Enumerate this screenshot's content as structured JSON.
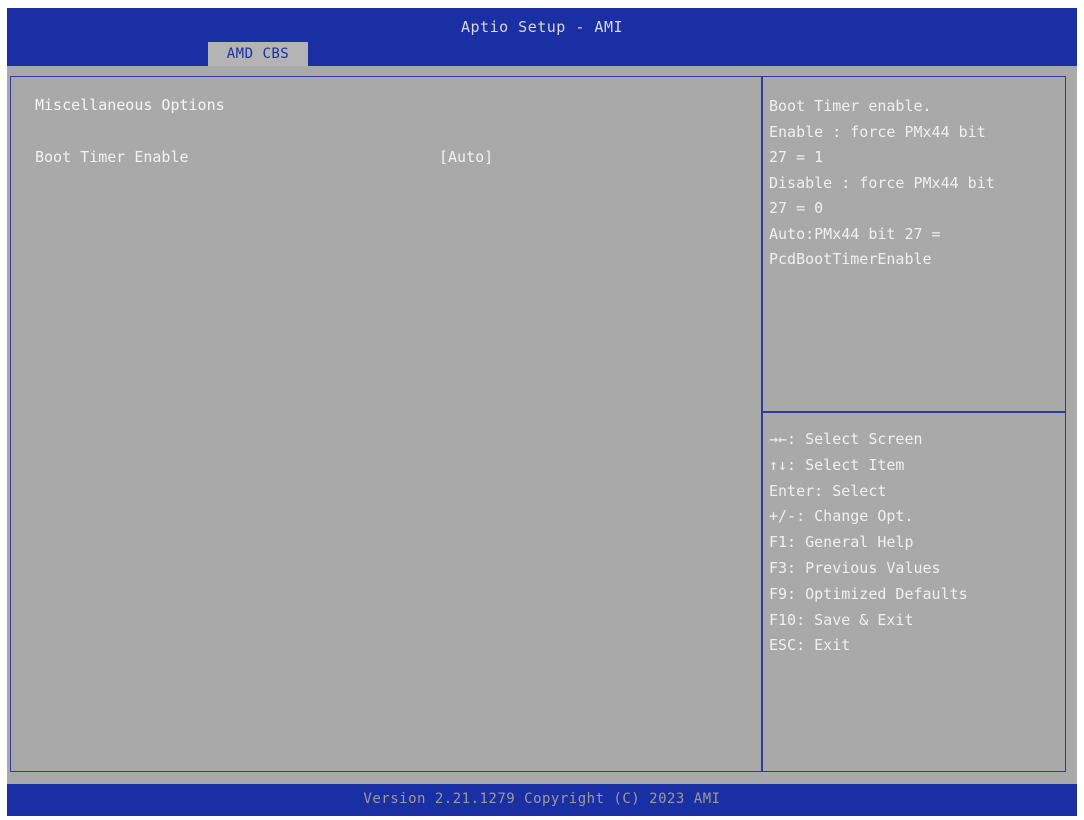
{
  "header": {
    "title": "Aptio Setup - AMI",
    "tabs": [
      {
        "label": "AMD CBS"
      }
    ]
  },
  "main": {
    "section_title": "Miscellaneous Options",
    "options": [
      {
        "label": "Boot Timer Enable",
        "value": "[Auto]"
      }
    ]
  },
  "help_panel": {
    "lines": [
      "Boot Timer enable.",
      "Enable : force PMx44 bit",
      "27 = 1",
      "Disable : force PMx44 bit",
      "27 = 0",
      "Auto:PMx44 bit 27 =",
      "PcdBootTimerEnable"
    ]
  },
  "key_legend": {
    "items": [
      "→←: Select Screen",
      "↑↓: Select Item",
      "Enter: Select",
      "+/-: Change Opt.",
      "F1: General Help",
      "F3: Previous Values",
      "F9: Optimized Defaults",
      "F10: Save & Exit",
      "ESC: Exit"
    ]
  },
  "footer": {
    "text": "Version 2.21.1279 Copyright (C) 2023 AMI"
  },
  "colors": {
    "header_bg": "#1a2fa3",
    "body_bg": "#a9a9a9",
    "tab_bg": "#b4b4b4",
    "text": "#f2f2f2",
    "border": "#2e3a9c"
  }
}
